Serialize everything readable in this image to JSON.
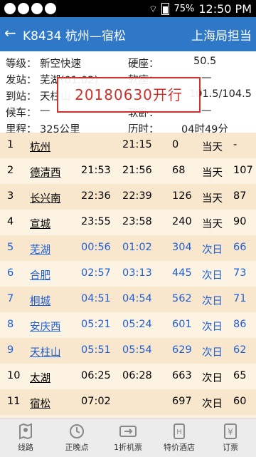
{
  "status_bar": {
    "battery": "75%",
    "time": "12:50 PM"
  },
  "header": {
    "back_icon": "arrow-left-icon",
    "title": "K8434 杭州—宿松",
    "bureau": "上海局担当"
  },
  "info": {
    "grade_label": "等级：",
    "grade": "新空快速",
    "hard_seat_label": "硬座：",
    "hard_seat": "50.5",
    "depart_label": "发站：",
    "depart": "芜湖(01:02)",
    "soft_seat_label": "软座：",
    "soft_seat": "—",
    "arrive_label": "到站：",
    "arrive": "天柱山",
    "hard_sleeper": "101.5/104.5",
    "wait_label": "候车：",
    "wait": "—",
    "soft_sleeper_label": "软卧：",
    "soft_sleeper": "—",
    "mileage_label": "里程：",
    "mileage": "325公里",
    "duration_label": "历时：",
    "duration": "04时49分",
    "stamp": "20180630开行"
  },
  "stops": [
    {
      "no": "1",
      "station": "杭州",
      "arr": "",
      "dep": "21:15",
      "km": "0",
      "day": "当天",
      "price": "-"
    },
    {
      "no": "2",
      "station": "德清西",
      "arr": "21:53",
      "dep": "21:56",
      "km": "68",
      "day": "当天",
      "price": "107"
    },
    {
      "no": "3",
      "station": "长兴南",
      "arr": "22:36",
      "dep": "22:39",
      "km": "126",
      "day": "当天",
      "price": "87"
    },
    {
      "no": "4",
      "station": "宣城",
      "arr": "23:55",
      "dep": "23:58",
      "km": "240",
      "day": "当天",
      "price": "90"
    },
    {
      "no": "5",
      "station": "芜湖",
      "arr": "00:56",
      "dep": "01:02",
      "km": "304",
      "day": "次日",
      "price": "66"
    },
    {
      "no": "6",
      "station": "合肥",
      "arr": "02:57",
      "dep": "03:13",
      "km": "445",
      "day": "次日",
      "price": "73"
    },
    {
      "no": "7",
      "station": "桐城",
      "arr": "04:51",
      "dep": "04:54",
      "km": "562",
      "day": "次日",
      "price": "71"
    },
    {
      "no": "8",
      "station": "安庆西",
      "arr": "05:21",
      "dep": "05:24",
      "km": "601",
      "day": "次日",
      "price": "86"
    },
    {
      "no": "9",
      "station": "天柱山",
      "arr": "05:51",
      "dep": "05:54",
      "km": "629",
      "day": "次日",
      "price": "62"
    },
    {
      "no": "10",
      "station": "太湖",
      "arr": "06:25",
      "dep": "06:28",
      "km": "663",
      "day": "次日",
      "price": "65"
    },
    {
      "no": "11",
      "station": "宿松",
      "arr": "07:02",
      "dep": "",
      "km": "697",
      "day": "次日",
      "price": "60"
    }
  ],
  "highlight_color": "#1f5fd6",
  "nav": [
    {
      "label": "线路",
      "icon": "map-icon"
    },
    {
      "label": "正晚点",
      "icon": "clock-icon"
    },
    {
      "label": "1折机票",
      "icon": "plane-ticket-icon"
    },
    {
      "label": "特价酒店",
      "icon": "hotel-icon"
    },
    {
      "label": "订票",
      "icon": "ticket-yen-icon"
    }
  ]
}
